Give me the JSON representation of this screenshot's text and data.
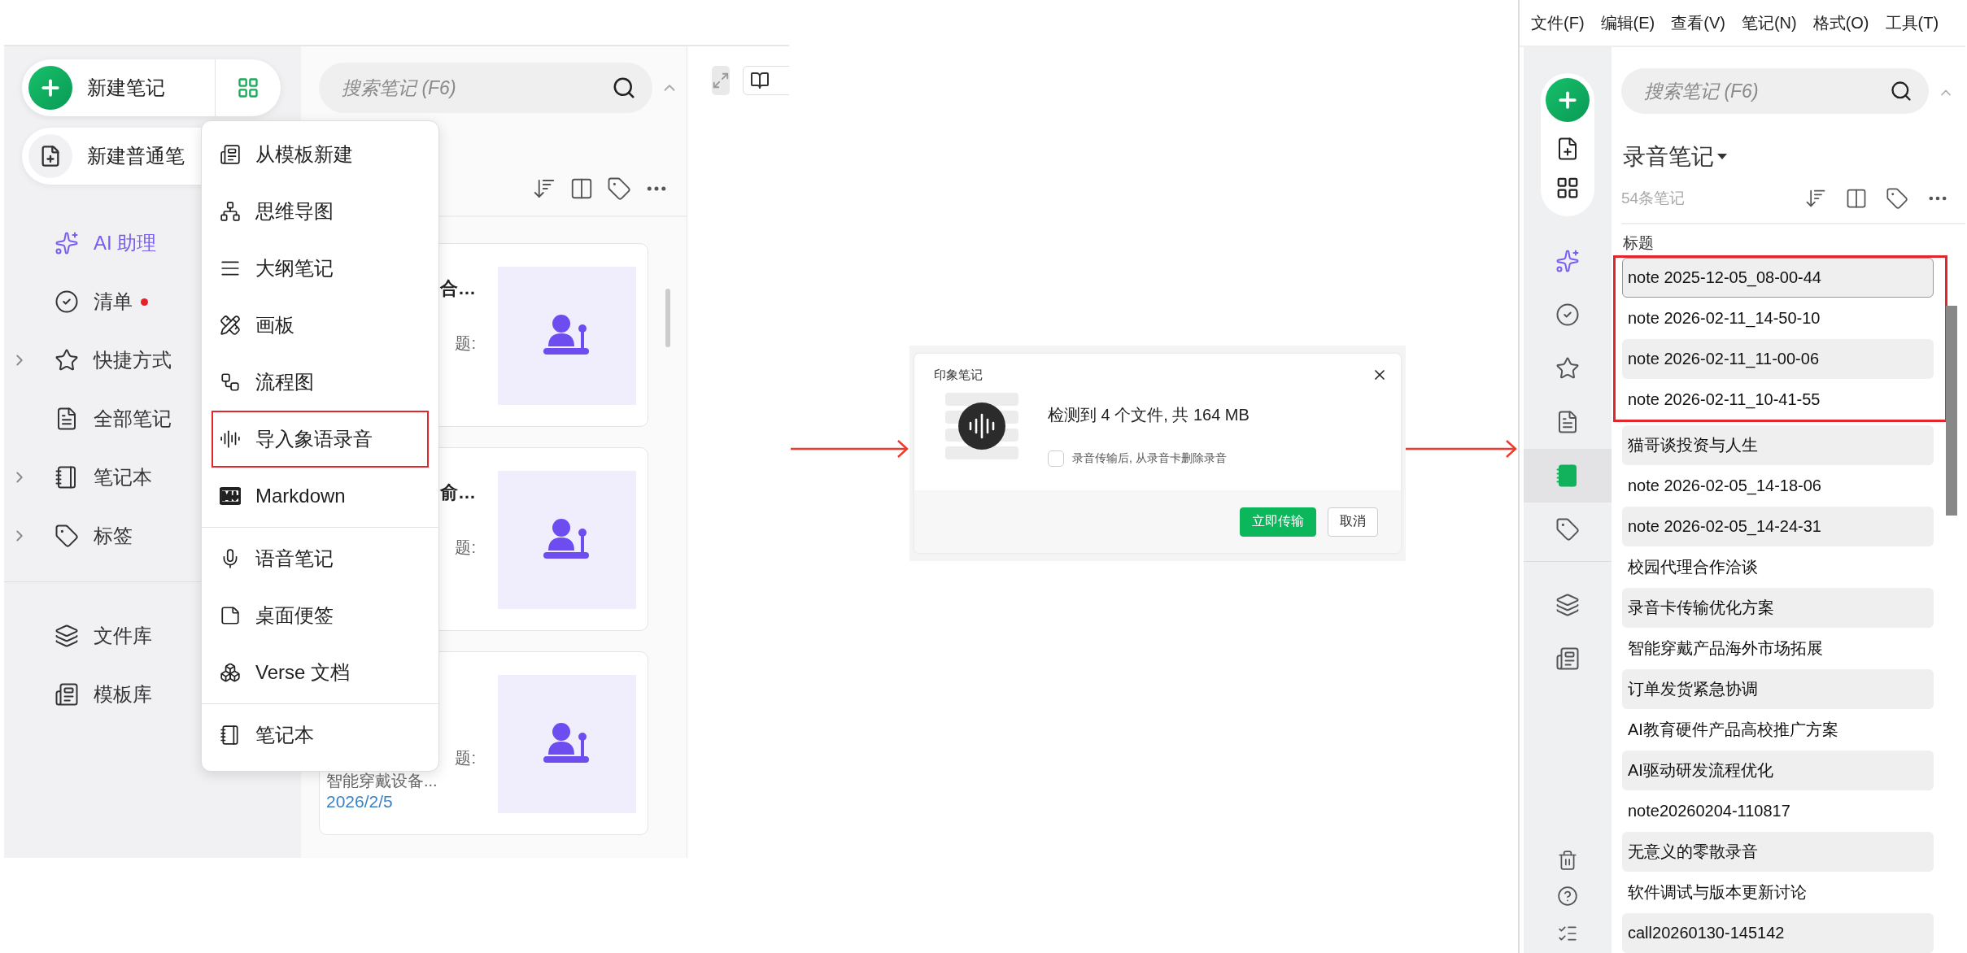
{
  "left_window": {
    "new_note_button": "新建笔记",
    "new_plain_note_button": "新建普通笔",
    "sidebar_items": [
      {
        "label": "AI 助理",
        "kind": "ai",
        "expandable": false,
        "dot": false
      },
      {
        "label": "清单",
        "kind": "nav",
        "expandable": false,
        "dot": true
      },
      {
        "label": "快捷方式",
        "kind": "nav",
        "expandable": true,
        "dot": false
      },
      {
        "label": "全部笔记",
        "kind": "nav",
        "expandable": false,
        "dot": false
      },
      {
        "label": "笔记本",
        "kind": "nav",
        "expandable": true,
        "dot": false
      },
      {
        "label": "标签",
        "kind": "nav",
        "expandable": true,
        "dot": false
      }
    ],
    "library_items": [
      "文件库",
      "模板库"
    ],
    "search": {
      "placeholder": "搜索笔记 (F6)"
    },
    "cards": [
      {
        "title": "合…",
        "lines": [
          {
            "text": "题:",
            "kind": "partial"
          }
        ]
      },
      {
        "title": "俞…",
        "lines": [
          {
            "text": "题:",
            "kind": "partial"
          }
        ]
      },
      {
        "lines": [
          {
            "text": "题:",
            "kind": "partial"
          },
          {
            "text": "智能穿戴设备...",
            "kind": "full"
          }
        ],
        "date": "2026/2/5"
      }
    ],
    "new_menu": [
      {
        "label": "从模板新建",
        "highlighted": false
      },
      {
        "label": "思维导图",
        "highlighted": false
      },
      {
        "label": "大纲笔记",
        "highlighted": false
      },
      {
        "label": "画板",
        "highlighted": false
      },
      {
        "label": "流程图",
        "highlighted": false
      },
      {
        "label": "导入象语录音",
        "highlighted": true
      },
      {
        "label": "Markdown",
        "highlighted": false
      },
      {
        "label": "语音笔记",
        "highlighted": false,
        "divider_before": true
      },
      {
        "label": "桌面便签",
        "highlighted": false
      },
      {
        "label": "Verse 文档",
        "highlighted": false
      },
      {
        "label": "笔记本",
        "highlighted": false,
        "divider_before": true
      }
    ]
  },
  "dialog": {
    "title": "印象笔记",
    "message": "检测到 4 个文件, 共 164 MB",
    "option": {
      "label": "录音传输后, 从录音卡删除录音",
      "checked": false
    },
    "buttons": [
      {
        "label": "立即传输",
        "kind": "primary"
      },
      {
        "label": "取消",
        "kind": "secondary"
      }
    ]
  },
  "right_window": {
    "menu_bar": [
      "文件(F)",
      "编辑(E)",
      "查看(V)",
      "笔记(N)",
      "格式(O)",
      "工具(T)"
    ],
    "rail_items": [
      {
        "selected": false
      },
      {
        "selected": false
      },
      {
        "selected": false
      },
      {
        "selected": false
      },
      {
        "selected": true
      },
      {
        "selected": false
      }
    ],
    "search": {
      "placeholder": "搜索笔记 (F6)"
    },
    "notebook_title": "录音笔记",
    "note_count": "54条笔记",
    "column_header": "标题",
    "boxed_rows": [
      {
        "title": "note 2025-12-05_08-00-44",
        "selected": true
      },
      {
        "title": "note 2026-02-11_14-50-10",
        "selected": false
      },
      {
        "title": "note 2026-02-11_11-00-06",
        "selected": false
      },
      {
        "title": "note 2026-02-11_10-41-55",
        "selected": false
      }
    ],
    "rows": [
      {
        "title": "猫哥谈投资与人生",
        "selected": false
      },
      {
        "title": "note 2026-02-05_14-18-06",
        "selected": false
      },
      {
        "title": "note 2026-02-05_14-24-31",
        "selected": false
      },
      {
        "title": "校园代理合作洽谈",
        "selected": false
      },
      {
        "title": "录音卡传输优化方案",
        "selected": false
      },
      {
        "title": "智能穿戴产品海外市场拓展",
        "selected": false
      },
      {
        "title": "订单发货紧急协调",
        "selected": false
      },
      {
        "title": "AI教育硬件产品高校推广方案",
        "selected": false
      },
      {
        "title": "AI驱动研发流程优化",
        "selected": false
      },
      {
        "title": "note20260204-110817",
        "selected": false
      },
      {
        "title": "无意义的零散录音",
        "selected": false
      },
      {
        "title": "软件调试与版本更新讨论",
        "selected": false
      },
      {
        "title": "call20260130-145142",
        "selected": false
      }
    ]
  }
}
